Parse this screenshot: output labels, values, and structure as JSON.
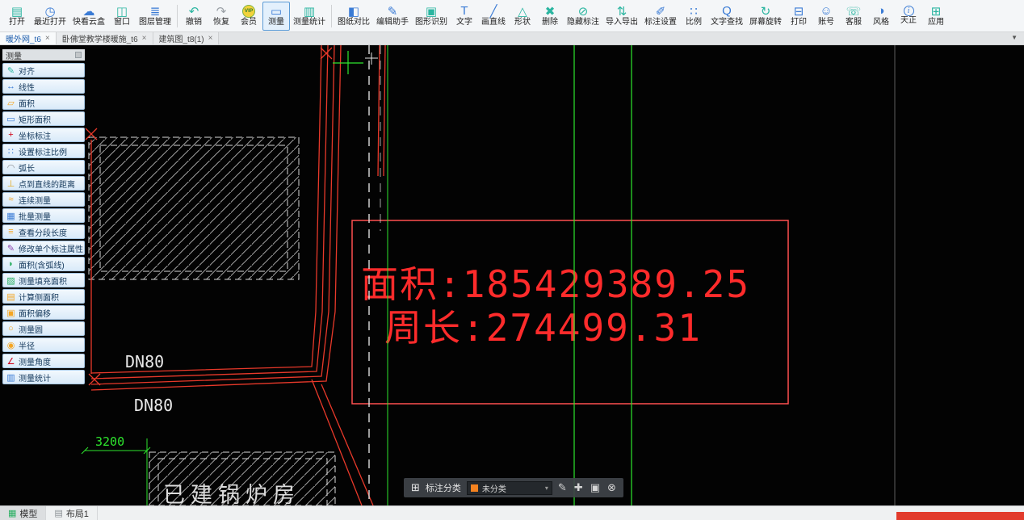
{
  "toolbar": {
    "items": [
      {
        "icon": "open",
        "label": "打开",
        "glyph": "▤",
        "color": "#2ab5a0"
      },
      {
        "icon": "recent-open",
        "label": "最近打开",
        "glyph": "◷",
        "color": "#3a7bd5"
      },
      {
        "icon": "cloud-box",
        "label": "快看云盒",
        "glyph": "☁",
        "color": "#3a7bd5"
      },
      {
        "icon": "window",
        "label": "窗口",
        "glyph": "◫",
        "color": "#2ab5a0"
      },
      {
        "icon": "layer-manager",
        "label": "图层管理",
        "glyph": "≣",
        "color": "#3a7bd5"
      },
      {
        "type": "separator"
      },
      {
        "icon": "undo",
        "label": "撤销",
        "glyph": "↶",
        "color": "#2ab5a0"
      },
      {
        "icon": "redo",
        "label": "恢复",
        "glyph": "↷",
        "color": "#9aa0a6"
      },
      {
        "icon": "vip-member",
        "label": "会员",
        "glyph": "VIP",
        "color": "#2e7d32",
        "shape": "vip"
      },
      {
        "icon": "measure",
        "label": "测量",
        "glyph": "▭",
        "color": "#3a7bd5",
        "active": true
      },
      {
        "icon": "measure-stats",
        "label": "测量统计",
        "glyph": "▥",
        "color": "#2ab5a0"
      },
      {
        "type": "separator"
      },
      {
        "icon": "drawing-compare",
        "label": "图纸对比",
        "glyph": "◧",
        "color": "#3a7bd5"
      },
      {
        "icon": "edit-assistant",
        "label": "编辑助手",
        "glyph": "✎",
        "color": "#3a7bd5"
      },
      {
        "icon": "shape-recognize",
        "label": "图形识别",
        "glyph": "▣",
        "color": "#2ab5a0"
      },
      {
        "icon": "text",
        "label": "文字",
        "glyph": "T",
        "color": "#3a7bd5"
      },
      {
        "icon": "draw-line",
        "label": "画直线",
        "glyph": "╱",
        "color": "#3a7bd5"
      },
      {
        "icon": "shapes",
        "label": "形状",
        "glyph": "△",
        "color": "#2ab5a0"
      },
      {
        "icon": "delete",
        "label": "删除",
        "glyph": "✖",
        "color": "#2ab5a0"
      },
      {
        "icon": "hide-annotation",
        "label": "隐藏标注",
        "glyph": "⊘",
        "color": "#2ab5a0"
      },
      {
        "icon": "import-export",
        "label": "导入导出",
        "glyph": "⇅",
        "color": "#2ab5a0"
      },
      {
        "icon": "annotation-settings",
        "label": "标注设置",
        "glyph": "✐",
        "color": "#3a7bd5"
      },
      {
        "icon": "scale",
        "label": "比例",
        "glyph": "∷",
        "color": "#3a7bd5"
      },
      {
        "icon": "text-search",
        "label": "文字查找",
        "glyph": "Q",
        "color": "#3a7bd5"
      },
      {
        "icon": "screen-rotate",
        "label": "屏幕旋转",
        "glyph": "↻",
        "color": "#2ab5a0"
      },
      {
        "icon": "print",
        "label": "打印",
        "glyph": "⊟",
        "color": "#3a7bd5"
      },
      {
        "icon": "account",
        "label": "账号",
        "glyph": "☺",
        "color": "#3a7bd5"
      },
      {
        "icon": "support",
        "label": "客服",
        "glyph": "☏",
        "color": "#2ab5a0"
      },
      {
        "icon": "style",
        "label": "风格",
        "glyph": "◑",
        "color": "#3a7bd5"
      },
      {
        "icon": "tianzheng",
        "label": "天正",
        "glyph": "i",
        "color": "#3a7bd5",
        "shape": "circle"
      },
      {
        "icon": "apps",
        "label": "应用",
        "glyph": "⊞",
        "color": "#2ab5a0"
      }
    ]
  },
  "tab_bar": {
    "tabs": [
      {
        "label": "暖外网_t6",
        "active": true
      },
      {
        "label": "卧佛堂教学楼暖施_t6",
        "active": false
      },
      {
        "label": "建筑图_t8(1)",
        "active": false
      }
    ],
    "close_glyph": "×",
    "collapse_glyph": "▼"
  },
  "sidebar": {
    "title": "测量",
    "items": [
      {
        "icon": "align",
        "label": "对齐",
        "glyph": "✎",
        "color": "#2ab5a0"
      },
      {
        "icon": "linear",
        "label": "线性",
        "glyph": "↔",
        "color": "#3a7bd5"
      },
      {
        "icon": "area",
        "label": "面积",
        "glyph": "▱",
        "color": "#f5a623"
      },
      {
        "icon": "rect-area",
        "label": "矩形面积",
        "glyph": "▭",
        "color": "#3a7bd5"
      },
      {
        "icon": "coord-annotation",
        "label": "坐标标注",
        "glyph": "+",
        "color": "#d0021b"
      },
      {
        "icon": "set-annotation-scale",
        "label": "设置标注比例",
        "glyph": "∷",
        "color": "#3a7bd5"
      },
      {
        "icon": "arc-length",
        "label": "弧长",
        "glyph": "◠",
        "color": "#8a8f94"
      },
      {
        "icon": "point-line-distance",
        "label": "点到直线的距离",
        "glyph": "⊥",
        "color": "#e6a817"
      },
      {
        "icon": "continuous-measure",
        "label": "连续测量",
        "glyph": "≈",
        "color": "#f5a623"
      },
      {
        "icon": "batch-measure",
        "label": "批量测量",
        "glyph": "▦",
        "color": "#3a7bd5"
      },
      {
        "icon": "segment-length",
        "label": "查看分段长度",
        "glyph": "≡",
        "color": "#f5a623"
      },
      {
        "icon": "modify-annotation",
        "label": "修改单个标注属性",
        "glyph": "✎",
        "color": "#8e44ad"
      },
      {
        "icon": "area-with-arc",
        "label": "面积(含弧线)",
        "glyph": "◗",
        "color": "#27ae60"
      },
      {
        "icon": "fill-area",
        "label": "测量填充面积",
        "glyph": "▨",
        "color": "#27ae60"
      },
      {
        "icon": "side-area",
        "label": "计算侧面积",
        "glyph": "▤",
        "color": "#f5a623"
      },
      {
        "icon": "area-offset",
        "label": "面积偏移",
        "glyph": "▣",
        "color": "#f5a623"
      },
      {
        "icon": "measure-circle",
        "label": "测量圆",
        "glyph": "○",
        "color": "#f5a623"
      },
      {
        "icon": "radius",
        "label": "半径",
        "glyph": "◉",
        "color": "#f5a623"
      },
      {
        "icon": "measure-angle",
        "label": "测量角度",
        "glyph": "∠",
        "color": "#d0021b"
      },
      {
        "icon": "measure-stats",
        "label": "测量统计",
        "glyph": "▥",
        "color": "#3a7bd5"
      }
    ]
  },
  "canvas": {
    "area_text": "面积:185429389.25",
    "perimeter_text": "周长:274499.31",
    "labels": {
      "dn80_top": "DN80",
      "dn80_bottom": "DN80",
      "dimension": "3200",
      "building": "已建锅炉房"
    },
    "colors": {
      "line_red": "#e8392a",
      "line_green": "#2ee62e",
      "measure_text": "#ff2b2b",
      "measure_box": "#ff5050",
      "hatch": "#cfcfcf"
    }
  },
  "annotation_bar": {
    "grid_icon_glyph": "⊞",
    "category_label": "标注分类",
    "dropdown_value": "未分类",
    "dropdown_color": "#f5821f",
    "dropdown_arrow": "▾",
    "actions": [
      {
        "icon": "edit",
        "glyph": "✎"
      },
      {
        "icon": "move",
        "glyph": "✚"
      },
      {
        "icon": "copy",
        "glyph": "▣"
      },
      {
        "icon": "delete",
        "glyph": "⊗"
      }
    ]
  },
  "status_bar": {
    "tabs": [
      {
        "icon": "model",
        "label": "模型",
        "glyph": "▦",
        "color": "#27ae60",
        "active": true
      },
      {
        "icon": "layout1",
        "label": "布局1",
        "glyph": "▤",
        "color": "#8a8f94",
        "active": false
      }
    ]
  }
}
